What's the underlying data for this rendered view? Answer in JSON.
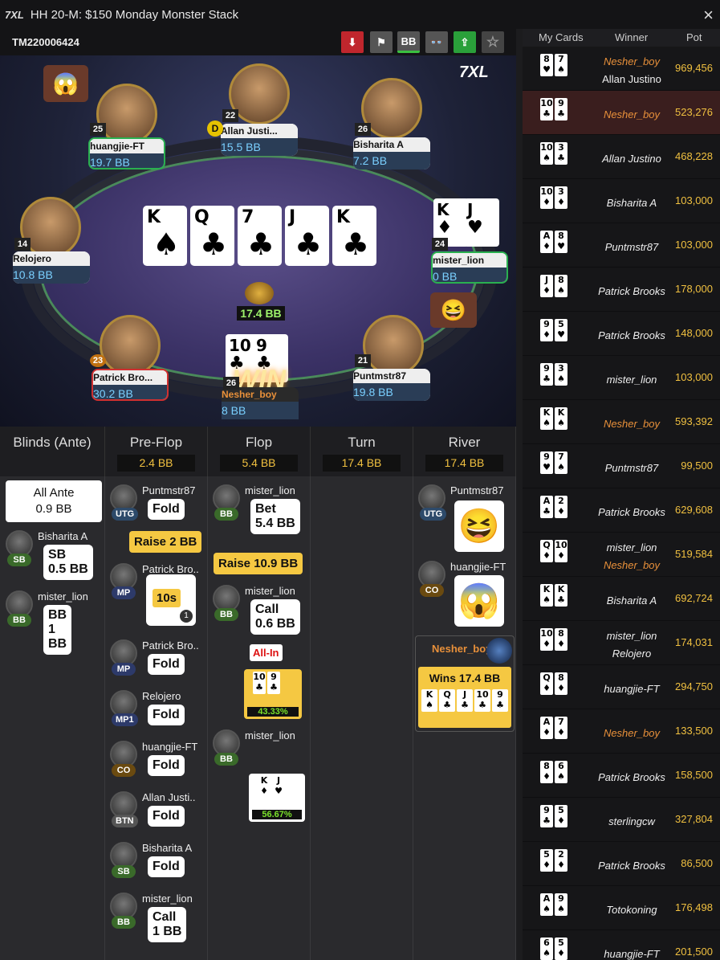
{
  "window": {
    "logo": "7XL",
    "title": "HH  20-M: $150 Monday Monster Stack",
    "close": "×"
  },
  "toolbar": {
    "tournament_id": "TM220006424",
    "download": "⬇",
    "report": "⚑",
    "bb": "BB",
    "incognito": "👓",
    "share": "⇪",
    "favorite": "☆"
  },
  "table": {
    "brand": "7XL",
    "board": [
      {
        "rank": "K",
        "suit": "♠",
        "red": false
      },
      {
        "rank": "Q",
        "suit": "♣",
        "red": false
      },
      {
        "rank": "7",
        "suit": "♣",
        "red": false
      },
      {
        "rank": "J",
        "suit": "♣",
        "red": false
      },
      {
        "rank": "K",
        "suit": "♣",
        "red": false
      }
    ],
    "pot": "17.4 BB",
    "win_text": "WIN",
    "seats": [
      {
        "name": "huangjie-FT",
        "stack": "19.7 BB",
        "level": "25"
      },
      {
        "name": "Allan Justi...",
        "stack": "15.5 BB",
        "level": "22"
      },
      {
        "name": "Bisharita A",
        "stack": "7.2 BB",
        "level": "26"
      },
      {
        "name": "Relojero",
        "stack": "10.8 BB",
        "level": "14"
      },
      {
        "name": "mister_lion",
        "stack": "0 BB",
        "level": "24"
      },
      {
        "name": "Patrick Bro...",
        "stack": "30.2 BB",
        "level": "23"
      },
      {
        "name": "Nesher_boy",
        "stack": "8 BB",
        "level": "26"
      },
      {
        "name": "Puntmstr87",
        "stack": "19.8 BB",
        "level": "21"
      }
    ],
    "mister_lion_cards": [
      {
        "rank": "K",
        "suit": "♦"
      },
      {
        "rank": "J",
        "suit": "♥"
      }
    ],
    "nesher_cards": [
      {
        "rank": "10",
        "suit": "♣"
      },
      {
        "rank": "9",
        "suit": "♣"
      }
    ],
    "dealer": "D"
  },
  "streets": {
    "blinds": {
      "title": "Blinds (Ante)",
      "ante_label": "All Ante",
      "ante_value": "0.9 BB"
    },
    "preflop": {
      "title": "Pre-Flop",
      "pot": "2.4 BB"
    },
    "flop": {
      "title": "Flop",
      "pot": "5.4 BB"
    },
    "turn": {
      "title": "Turn",
      "pot": "17.4 BB"
    },
    "river": {
      "title": "River",
      "pot": "17.4 BB"
    }
  },
  "actions": {
    "sb": {
      "name": "Bisharita A",
      "pos": "SB",
      "text": "SB\n0.5 BB"
    },
    "bb": {
      "name": "mister_lion",
      "pos": "BB",
      "text": "BB 1 BB"
    },
    "pf": [
      {
        "name": "Puntmstr87",
        "pos": "UTG",
        "text": "Fold"
      },
      {
        "name": "Patrick Bro..",
        "pos": "MP",
        "text": "10s"
      },
      {
        "name": "Patrick Bro..",
        "pos": "MP",
        "text": "Fold"
      },
      {
        "name": "Relojero",
        "pos": "MP1",
        "text": "Fold"
      },
      {
        "name": "huangjie-FT",
        "pos": "CO",
        "text": "Fold"
      },
      {
        "name": "Allan Justi..",
        "pos": "BTN",
        "text": "Fold"
      },
      {
        "name": "Bisharita A",
        "pos": "SB",
        "text": "Fold"
      },
      {
        "name": "mister_lion",
        "pos": "BB",
        "text": "Call\n1 BB"
      }
    ],
    "raise_pf": "Raise 2 BB",
    "timer_badge": "1",
    "flop": [
      {
        "name": "mister_lion",
        "pos": "BB",
        "text": "Bet\n5.4 BB"
      },
      {
        "name": "mister_lion",
        "pos": "BB",
        "text": "Call\n0.6 BB"
      },
      {
        "name": "mister_lion",
        "pos": "BB",
        "text": ""
      }
    ],
    "raise_flop": "Raise 10.9 BB",
    "allin": "All-In",
    "equity_hero": "43.33%",
    "equity_villain": "56.67%",
    "river": [
      {
        "name": "Puntmstr87",
        "pos": "UTG"
      },
      {
        "name": "huangjie-FT",
        "pos": "CO"
      }
    ],
    "winner": {
      "name": "Nesher_boy",
      "text": "Wins 17.4 BB",
      "cards": [
        {
          "rank": "K",
          "suit": "♠"
        },
        {
          "rank": "Q",
          "suit": "♣"
        },
        {
          "rank": "J",
          "suit": "♣"
        },
        {
          "rank": "10",
          "suit": "♣"
        },
        {
          "rank": "9",
          "suit": "♣"
        }
      ]
    }
  },
  "history": {
    "headers": [
      "My Cards",
      "Winner",
      "Pot"
    ],
    "rows": [
      {
        "c1": "8",
        "s1": "♥",
        "c2": "7",
        "s2": "♠",
        "winners": [
          "Nesher_boy",
          "Allan Justino"
        ],
        "pot": "969,456"
      },
      {
        "c1": "10",
        "s1": "♣",
        "c2": "9",
        "s2": "♣",
        "winners": [
          "Nesher_boy"
        ],
        "pot": "523,276"
      },
      {
        "c1": "10",
        "s1": "♠",
        "c2": "3",
        "s2": "♣",
        "winners": [
          "Allan Justino"
        ],
        "pot": "468,228"
      },
      {
        "c1": "10",
        "s1": "♦",
        "c2": "3",
        "s2": "♦",
        "winners": [
          "Bisharita A"
        ],
        "pot": "103,000"
      },
      {
        "c1": "A",
        "s1": "♦",
        "c2": "8",
        "s2": "♥",
        "winners": [
          "Puntmstr87"
        ],
        "pot": "103,000"
      },
      {
        "c1": "J",
        "s1": "♦",
        "c2": "8",
        "s2": "♠",
        "winners": [
          "Patrick Brooks"
        ],
        "pot": "178,000"
      },
      {
        "c1": "9",
        "s1": "♦",
        "c2": "5",
        "s2": "♥",
        "winners": [
          "Patrick Brooks"
        ],
        "pot": "148,000"
      },
      {
        "c1": "9",
        "s1": "♣",
        "c2": "3",
        "s2": "♠",
        "winners": [
          "mister_lion"
        ],
        "pot": "103,000"
      },
      {
        "c1": "K",
        "s1": "♠",
        "c2": "K",
        "s2": "♠",
        "winners": [
          "Nesher_boy"
        ],
        "pot": "593,392"
      },
      {
        "c1": "9",
        "s1": "♥",
        "c2": "7",
        "s2": "♠",
        "winners": [
          "Puntmstr87"
        ],
        "pot": "99,500"
      },
      {
        "c1": "A",
        "s1": "♣",
        "c2": "2",
        "s2": "♦",
        "winners": [
          "Patrick Brooks"
        ],
        "pot": "629,608"
      },
      {
        "c1": "Q",
        "s1": "♦",
        "c2": "10",
        "s2": "♦",
        "winners": [
          "mister_lion",
          "Nesher_boy"
        ],
        "pot": "519,584"
      },
      {
        "c1": "K",
        "s1": "♠",
        "c2": "K",
        "s2": "♣",
        "winners": [
          "Bisharita A"
        ],
        "pot": "692,724"
      },
      {
        "c1": "10",
        "s1": "♦",
        "c2": "8",
        "s2": "♦",
        "winners": [
          "mister_lion",
          "Relojero"
        ],
        "pot": "174,031"
      },
      {
        "c1": "Q",
        "s1": "♦",
        "c2": "8",
        "s2": "♦",
        "winners": [
          "huangjie-FT"
        ],
        "pot": "294,750"
      },
      {
        "c1": "A",
        "s1": "♦",
        "c2": "7",
        "s2": "♦",
        "winners": [
          "Nesher_boy"
        ],
        "pot": "133,500"
      },
      {
        "c1": "8",
        "s1": "♦",
        "c2": "6",
        "s2": "♠",
        "winners": [
          "Patrick Brooks"
        ],
        "pot": "158,500"
      },
      {
        "c1": "9",
        "s1": "♣",
        "c2": "5",
        "s2": "♦",
        "winners": [
          "sterlingcw"
        ],
        "pot": "327,804"
      },
      {
        "c1": "5",
        "s1": "♦",
        "c2": "2",
        "s2": "♦",
        "winners": [
          "Patrick Brooks"
        ],
        "pot": "86,500"
      },
      {
        "c1": "A",
        "s1": "♠",
        "c2": "9",
        "s2": "♠",
        "winners": [
          "Totokoning"
        ],
        "pot": "176,498"
      },
      {
        "c1": "6",
        "s1": "♠",
        "c2": "5",
        "s2": "♦",
        "winners": [
          "huangjie-FT"
        ],
        "pot": "201,500"
      }
    ]
  }
}
